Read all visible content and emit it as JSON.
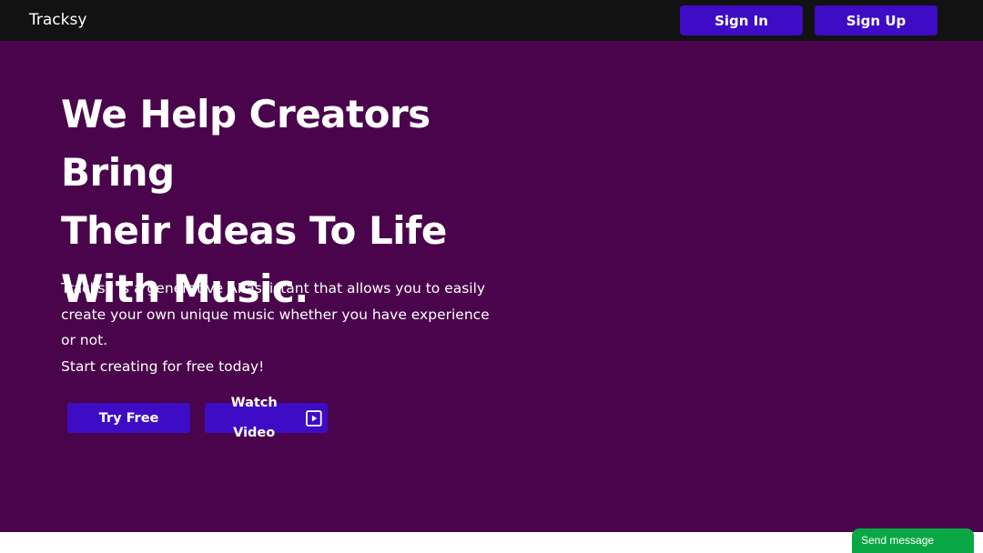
{
  "header": {
    "brand": "Tracksy",
    "sign_in_label": "Sign In",
    "sign_up_label": "Sign Up"
  },
  "hero": {
    "headline_line1": "We Help Creators Bring",
    "headline_line2": "Their Ideas To Life",
    "headline_line3": "With Music.",
    "description": "Tracksy is a generative AI assistant that allows you to easily create your own unique music whether you have experience or not.",
    "cta_text": "Start creating for free today!",
    "try_free_label": "Try Free",
    "watch_video_label": "Watch Video",
    "watch_video_icon": "play-icon"
  },
  "chat_widget": {
    "label": "Send message"
  },
  "colors": {
    "topbar_bg": "#121212",
    "hero_bg": "#4a044c",
    "button_bg": "#3d0cc4",
    "chat_bg": "#0aa845"
  }
}
